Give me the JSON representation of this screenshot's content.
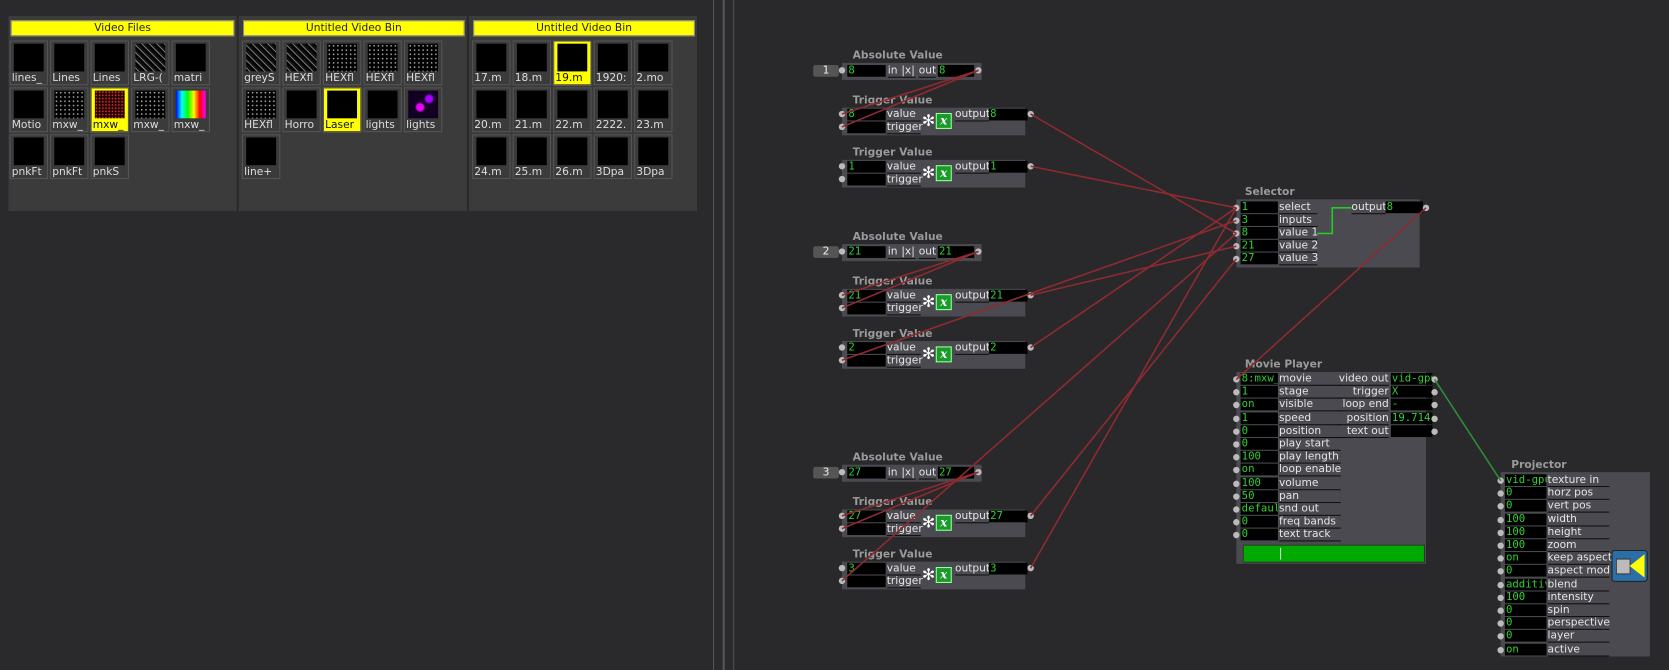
{
  "bins": [
    {
      "title": "Video Files",
      "items": [
        {
          "label": "lines_",
          "thumb": "black"
        },
        {
          "label": "Lines",
          "thumb": "black"
        },
        {
          "label": "Lines",
          "thumb": "black"
        },
        {
          "label": "LRG-(",
          "thumb": "noise"
        },
        {
          "label": "matri",
          "thumb": "black"
        },
        {
          "label": "Motio",
          "thumb": "black"
        },
        {
          "label": "mxw_",
          "thumb": "dots"
        },
        {
          "label": "mxw_",
          "thumb": "reddots",
          "selected": true
        },
        {
          "label": "mxw_",
          "thumb": "dots"
        },
        {
          "label": "mxw_",
          "thumb": "rainbow"
        },
        {
          "label": "pnkFt",
          "thumb": "black"
        },
        {
          "label": "pnkFt",
          "thumb": "black"
        },
        {
          "label": "pnkS",
          "thumb": "black"
        }
      ]
    },
    {
      "title": "Untitled Video Bin",
      "items": [
        {
          "label": "greyS",
          "thumb": "noise"
        },
        {
          "label": "HEXfl",
          "thumb": "noise"
        },
        {
          "label": "HEXfl",
          "thumb": "dots"
        },
        {
          "label": "HEXfl",
          "thumb": "dots"
        },
        {
          "label": "HEXfl",
          "thumb": "dots"
        },
        {
          "label": "HEXfl",
          "thumb": "dots"
        },
        {
          "label": "Horro",
          "thumb": "black"
        },
        {
          "label": "Laser",
          "thumb": "black",
          "selected": true
        },
        {
          "label": "lights",
          "thumb": "black"
        },
        {
          "label": "lights",
          "thumb": "purple"
        },
        {
          "label": "line+",
          "thumb": "black"
        }
      ]
    },
    {
      "title": "Untitled Video Bin",
      "items": [
        {
          "label": "17.m",
          "thumb": "black"
        },
        {
          "label": "18.m",
          "thumb": "black"
        },
        {
          "label": "19.m",
          "thumb": "black",
          "selected": true
        },
        {
          "label": "1920:",
          "thumb": "black"
        },
        {
          "label": "2.mo",
          "thumb": "black"
        },
        {
          "label": "20.m",
          "thumb": "black"
        },
        {
          "label": "21.m",
          "thumb": "black"
        },
        {
          "label": "22.m",
          "thumb": "black"
        },
        {
          "label": "2222.",
          "thumb": "black"
        },
        {
          "label": "23.m",
          "thumb": "black"
        },
        {
          "label": "24.m",
          "thumb": "black"
        },
        {
          "label": "25.m",
          "thumb": "black"
        },
        {
          "label": "26.m",
          "thumb": "black"
        },
        {
          "label": "3Dpa",
          "thumb": "black"
        },
        {
          "label": "3Dpa",
          "thumb": "black"
        }
      ]
    }
  ],
  "labels": {
    "in": "in",
    "abs": "|x|",
    "out": "out",
    "value": "value",
    "trigger": "trigger",
    "output": "output"
  },
  "absolute": [
    {
      "title": "Absolute Value",
      "number_box": "1",
      "in": "8",
      "out": "8"
    },
    {
      "title": "Absolute Value",
      "number_box": "2",
      "in": "21",
      "out": "21"
    },
    {
      "title": "Absolute Value",
      "number_box": "3",
      "in": "27",
      "out": "27"
    }
  ],
  "triggers": [
    {
      "title": "Trigger Value",
      "value": "8",
      "trigger": "",
      "output": "8"
    },
    {
      "title": "Trigger Value",
      "value": "1",
      "trigger": "",
      "output": "1"
    },
    {
      "title": "Trigger Value",
      "value": "21",
      "trigger": "",
      "output": "21"
    },
    {
      "title": "Trigger Value",
      "value": "2",
      "trigger": "",
      "output": "2"
    },
    {
      "title": "Trigger Value",
      "value": "27",
      "trigger": "",
      "output": "27"
    },
    {
      "title": "Trigger Value",
      "value": "3",
      "trigger": "",
      "output": "3"
    }
  ],
  "selector": {
    "title": "Selector",
    "inputs": [
      {
        "label": "select",
        "value": "1"
      },
      {
        "label": "inputs",
        "value": "3"
      },
      {
        "label": "value 1",
        "value": "8"
      },
      {
        "label": "value 2",
        "value": "21"
      },
      {
        "label": "value 3",
        "value": "27"
      }
    ],
    "output": {
      "label": "output",
      "value": "8"
    }
  },
  "movie_player": {
    "title": "Movie Player",
    "inputs": [
      {
        "label": "movie",
        "value": "8:mxw_"
      },
      {
        "label": "stage",
        "value": "1"
      },
      {
        "label": "visible",
        "value": "on"
      },
      {
        "label": "speed",
        "value": "1"
      },
      {
        "label": "position",
        "value": "0"
      },
      {
        "label": "play start",
        "value": "0"
      },
      {
        "label": "play length",
        "value": "100"
      },
      {
        "label": "loop enable",
        "value": "on"
      },
      {
        "label": "volume",
        "value": "100"
      },
      {
        "label": "pan",
        "value": "50"
      },
      {
        "label": "snd out",
        "value": "default"
      },
      {
        "label": "freq bands",
        "value": "0"
      },
      {
        "label": "text track",
        "value": "0"
      }
    ],
    "outputs": [
      {
        "label": "video out",
        "value": "vid-gpu"
      },
      {
        "label": "trigger",
        "value": "X"
      },
      {
        "label": "loop end",
        "value": "-"
      },
      {
        "label": "position",
        "value": "19.714"
      },
      {
        "label": "text out",
        "value": ""
      }
    ],
    "progress_percent": 20
  },
  "projector": {
    "title": "Projector",
    "icon": "projector-icon",
    "inputs": [
      {
        "label": "texture in",
        "value": "vid-gpu"
      },
      {
        "label": "horz pos",
        "value": "0"
      },
      {
        "label": "vert pos",
        "value": "0"
      },
      {
        "label": "width",
        "value": "100"
      },
      {
        "label": "height",
        "value": "100"
      },
      {
        "label": "zoom",
        "value": "100"
      },
      {
        "label": "keep aspect",
        "value": "on"
      },
      {
        "label": "aspect mod",
        "value": "0"
      },
      {
        "label": "blend",
        "value": "additive"
      },
      {
        "label": "intensity",
        "value": "100"
      },
      {
        "label": "spin",
        "value": "0"
      },
      {
        "label": "perspective",
        "value": "0"
      },
      {
        "label": "layer",
        "value": "0"
      },
      {
        "label": "active",
        "value": "on"
      }
    ]
  },
  "colors": {
    "bin_header": "#ffff00",
    "field_text": "#2ed12e",
    "wire": "#8e2a30",
    "video_wire": "#2f8a3a",
    "progress": "#00aa00"
  }
}
